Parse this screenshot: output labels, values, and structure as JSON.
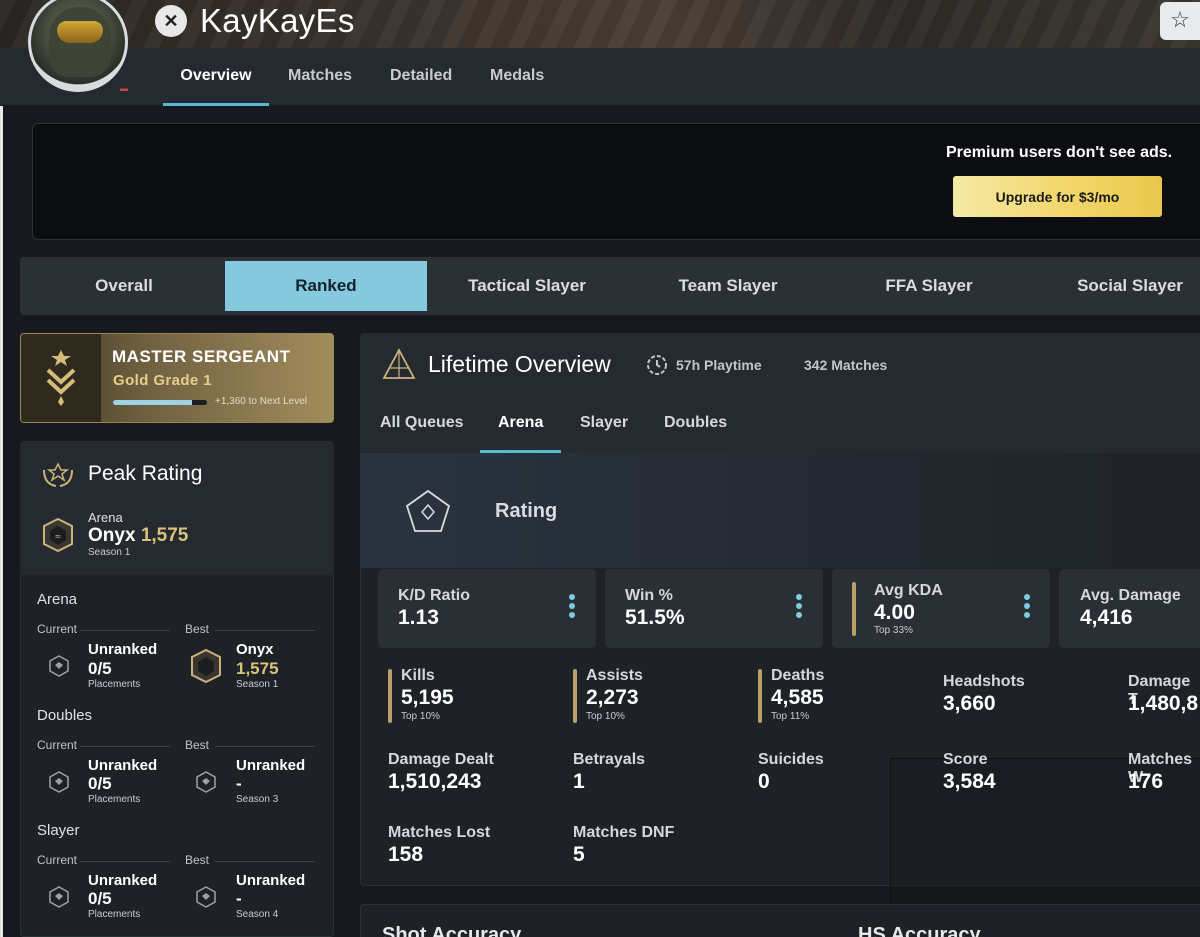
{
  "profile": {
    "username": "KayKayEs",
    "platform_icon": "xbox-icon",
    "nav_tabs": [
      "Overview",
      "Matches",
      "Detailed",
      "Medals"
    ],
    "active_nav": "Overview"
  },
  "ad": {
    "text": "Premium users don't see ads.",
    "button": "Upgrade for $3/mo"
  },
  "modes": {
    "tabs": [
      "Overall",
      "Ranked",
      "Tactical Slayer",
      "Team Slayer",
      "FFA Slayer",
      "Social Slayer"
    ],
    "active": "Ranked"
  },
  "rank": {
    "title": "MASTER SERGEANT",
    "grade": "Gold Grade 1",
    "next_level": "+1,360 to Next Level",
    "progress": 0.84
  },
  "peak": {
    "title": "Peak Rating",
    "queue": "Arena",
    "tier": "Onyx",
    "rating": "1,575",
    "season": "Season 1"
  },
  "playlists": [
    {
      "name": "Arena",
      "current_label": "Current",
      "best_label": "Best",
      "current_rank": "Unranked",
      "current_value": "0/5",
      "current_sub": "Placements",
      "best_rank": "Onyx",
      "best_value": "1,575",
      "best_sub": "Season 1"
    },
    {
      "name": "Doubles",
      "current_label": "Current",
      "best_label": "Best",
      "current_rank": "Unranked",
      "current_value": "0/5",
      "current_sub": "Placements",
      "best_rank": "Unranked",
      "best_value": "-",
      "best_sub": "Season 3"
    },
    {
      "name": "Slayer",
      "current_label": "Current",
      "best_label": "Best",
      "current_rank": "Unranked",
      "current_value": "0/5",
      "current_sub": "Placements",
      "best_rank": "Unranked",
      "best_value": "-",
      "best_sub": "Season 4"
    }
  ],
  "lifetime": {
    "title": "Lifetime Overview",
    "playtime": "57h Playtime",
    "matches": "342 Matches",
    "queue_tabs": [
      "All Queues",
      "Arena",
      "Slayer",
      "Doubles"
    ],
    "active_queue": "Arena",
    "rating_label": "Rating",
    "cards": [
      {
        "label": "K/D Ratio",
        "value": "1.13"
      },
      {
        "label": "Win %",
        "value": "51.5%"
      },
      {
        "label": "Avg KDA",
        "value": "4.00",
        "sub": "Top 33%"
      },
      {
        "label": "Avg. Damage",
        "value": "4,416"
      }
    ],
    "stats": [
      {
        "label": "Kills",
        "value": "5,195",
        "sub": "Top 10%"
      },
      {
        "label": "Assists",
        "value": "2,273",
        "sub": "Top 10%"
      },
      {
        "label": "Deaths",
        "value": "4,585",
        "sub": "Top 11%"
      },
      {
        "label": "Headshots",
        "value": "3,660"
      },
      {
        "label": "Damage T",
        "value": "1,480,8"
      },
      {
        "label": "Damage Dealt",
        "value": "1,510,243"
      },
      {
        "label": "Betrayals",
        "value": "1"
      },
      {
        "label": "Suicides",
        "value": "0"
      },
      {
        "label": "Score",
        "value": "3,584"
      },
      {
        "label": "Matches W",
        "value": "176"
      },
      {
        "label": "Matches Lost",
        "value": "158"
      },
      {
        "label": "Matches DNF",
        "value": "5"
      }
    ]
  },
  "bottom": {
    "left_title": "Shot Accuracy",
    "right_title": "HS Accuracy"
  },
  "colors": {
    "accent": "#58b9d2",
    "active_tab": "#86c9de",
    "gold": "#d9c37a",
    "button_gold": "#f3d66a"
  }
}
